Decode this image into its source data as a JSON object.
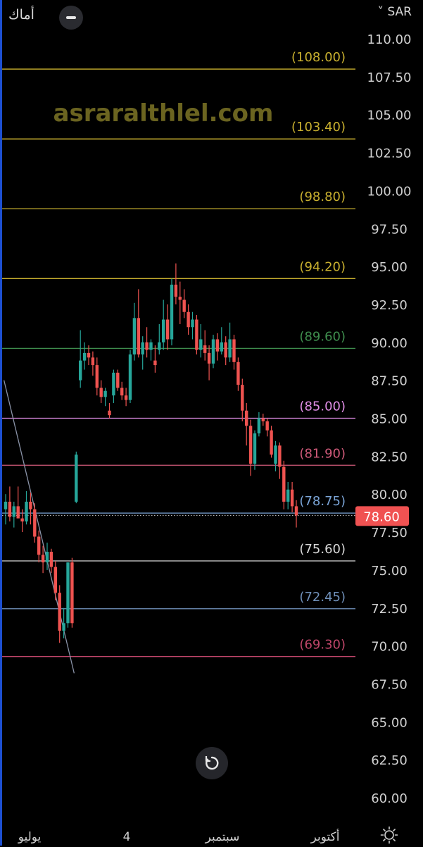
{
  "header": {
    "symbol_name": "أماك",
    "currency": "SAR",
    "currency_caret": "˅"
  },
  "watermark": "asraralthlel.com",
  "icons": [
    "minus-icon",
    "reset-icon",
    "gear-icon"
  ],
  "chart_data": {
    "type": "candlestick",
    "y_axis": {
      "ylim": [
        58.4,
        110.8
      ],
      "ticks": [
        "110.00",
        "107.50",
        "105.00",
        "102.50",
        "100.00",
        "97.50",
        "95.00",
        "92.50",
        "90.00",
        "87.50",
        "85.00",
        "82.50",
        "80.00",
        "77.50",
        "75.00",
        "72.50",
        "70.00",
        "67.50",
        "65.00",
        "62.50",
        "60.00"
      ]
    },
    "x_axis": {
      "labels": [
        "يوليو",
        "4",
        "سبتمبر",
        "أكتوبر"
      ]
    },
    "levels": [
      {
        "label": "(108.00)",
        "value": 108.0,
        "color": "#c9b02f"
      },
      {
        "label": "(103.40)",
        "value": 103.4,
        "color": "#c9b02f"
      },
      {
        "label": "(98.80)",
        "value": 98.8,
        "color": "#c9b02f"
      },
      {
        "label": "(94.20)",
        "value": 94.2,
        "color": "#c9b02f"
      },
      {
        "label": "(89.60)",
        "value": 89.6,
        "color": "#3f8e4e"
      },
      {
        "label": "(85.00)",
        "value": 85.0,
        "color": "#e08ee6"
      },
      {
        "label": "(81.90)",
        "value": 81.9,
        "color": "#d05a7a"
      },
      {
        "label": "(78.75)",
        "value": 78.75,
        "color": "#7aa4d6"
      },
      {
        "label": "(75.60)",
        "value": 75.6,
        "color": "#d8d8d8"
      },
      {
        "label": "(72.45)",
        "value": 72.45,
        "color": "#6f8fb8"
      },
      {
        "label": "(69.30)",
        "value": 69.3,
        "color": "#c0466a"
      }
    ],
    "current_price": "78.60",
    "current_value": 78.6,
    "colors": {
      "up": "#26a69a",
      "down": "#ef5350",
      "price_badge": "#f05252"
    },
    "candles": [
      [
        79,
        80,
        78,
        79.5
      ],
      [
        79.5,
        80.5,
        78.2,
        78.5
      ],
      [
        78.5,
        79.5,
        77.8,
        79.2
      ],
      [
        79.2,
        80.5,
        78.8,
        78.4
      ],
      [
        78.4,
        79,
        77.5,
        78.2
      ],
      [
        78.2,
        80.2,
        78,
        79.5
      ],
      [
        79.5,
        80.1,
        78,
        79
      ],
      [
        79,
        79.4,
        76.8,
        77.2
      ],
      [
        77.2,
        77.6,
        75.5,
        76
      ],
      [
        76,
        76.6,
        74.8,
        75.5
      ],
      [
        75.5,
        76.8,
        75,
        76.2
      ],
      [
        76.2,
        76.4,
        74.8,
        75.2
      ],
      [
        75.2,
        75.6,
        73,
        73.5
      ],
      [
        73.5,
        74,
        70.2,
        71
      ],
      [
        71,
        72.5,
        70.5,
        71.5
      ],
      [
        71.5,
        75.5,
        71.2,
        75.5
      ],
      [
        75.5,
        75.8,
        71.2,
        71.5
      ],
      [
        79.5,
        82.8,
        79.4,
        82.6
      ],
      [
        87.5,
        90.8,
        87,
        88.8
      ],
      [
        88.8,
        90,
        88.2,
        89.3
      ],
      [
        89.3,
        89.8,
        88.5,
        89
      ],
      [
        89,
        89.4,
        87.8,
        88.5
      ],
      [
        88.5,
        89,
        86.5,
        87
      ],
      [
        87,
        87.5,
        86,
        86.4
      ],
      [
        86.4,
        87,
        85.8,
        86.8
      ],
      [
        85.5,
        86,
        85,
        85.2
      ],
      [
        86.5,
        88.2,
        86,
        88
      ],
      [
        88,
        88.2,
        86.8,
        87
      ],
      [
        87,
        87.4,
        86.2,
        86.5
      ],
      [
        86.5,
        87,
        85.8,
        86.2
      ],
      [
        86.2,
        89.5,
        86,
        89.2
      ],
      [
        89.2,
        92.6,
        88.8,
        91.6
      ],
      [
        91.6,
        93.5,
        89,
        89.2
      ],
      [
        89.2,
        90.4,
        88.2,
        90
      ],
      [
        90,
        91,
        89,
        89.5
      ],
      [
        89.5,
        90.2,
        88.8,
        90
      ],
      [
        88.8,
        89.8,
        88,
        88.5
      ],
      [
        89.5,
        91.2,
        89.2,
        90
      ],
      [
        90,
        92.8,
        89.5,
        91.5
      ],
      [
        91.5,
        92.5,
        89.5,
        90.2
      ],
      [
        90.2,
        94.2,
        89.8,
        93.8
      ],
      [
        93.8,
        95.2,
        92.5,
        93
      ],
      [
        93,
        94,
        91.2,
        92.8
      ],
      [
        92.8,
        93.5,
        91.6,
        92
      ],
      [
        92,
        92.5,
        90.5,
        91
      ],
      [
        91,
        92,
        90.2,
        91.5
      ],
      [
        91.5,
        91.8,
        89.2,
        89.5
      ],
      [
        89.5,
        91.2,
        89,
        90.2
      ],
      [
        89.8,
        90.8,
        88.8,
        89.3
      ],
      [
        89.3,
        89.8,
        87.5,
        88.6
      ],
      [
        88.6,
        90.5,
        88.3,
        90.2
      ],
      [
        90.2,
        90.6,
        88.8,
        89.4
      ],
      [
        89.4,
        91,
        89.2,
        90
      ],
      [
        90,
        90.4,
        88.5,
        89
      ],
      [
        89,
        91.3,
        88.7,
        90.2
      ],
      [
        90.2,
        90.5,
        88.2,
        88.7
      ],
      [
        88.7,
        89,
        86.8,
        87.2
      ],
      [
        87.2,
        87.6,
        84.8,
        85.5
      ],
      [
        85.5,
        86,
        83.2,
        84.5
      ],
      [
        84.5,
        84.9,
        81.2,
        82
      ],
      [
        82,
        84.2,
        81.6,
        84
      ],
      [
        84,
        85.4,
        83.8,
        85
      ],
      [
        85,
        85.3,
        84.5,
        84.8
      ],
      [
        84.8,
        85,
        83.8,
        84.2
      ],
      [
        84.2,
        84.5,
        82.4,
        82.6
      ],
      [
        82,
        83.5,
        81.5,
        83.2
      ],
      [
        83.2,
        83.4,
        81,
        81.8
      ],
      [
        81.8,
        82.2,
        79,
        79.5
      ],
      [
        79.5,
        80.8,
        79,
        80.3
      ],
      [
        80.3,
        80.8,
        78.8,
        79.2
      ],
      [
        79.2,
        79.6,
        77.8,
        78.6
      ]
    ],
    "trendline": {
      "from": [
        -0.4,
        87.5
      ],
      "to": [
        16.5,
        68.2
      ]
    }
  }
}
